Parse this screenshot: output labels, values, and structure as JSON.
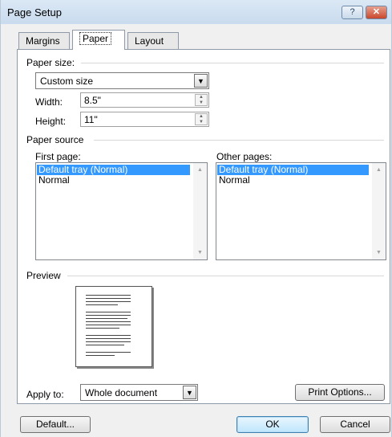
{
  "window": {
    "title": "Page Setup",
    "help_glyph": "?",
    "close_glyph": "✕"
  },
  "tabs": [
    {
      "label": "Margins"
    },
    {
      "label": "Paper"
    },
    {
      "label": "Layout"
    }
  ],
  "paper_size": {
    "heading": "Paper size:",
    "selected": "Custom size",
    "width_label": "Width:",
    "width_value": "8.5\"",
    "height_label": "Height:",
    "height_value": "11\""
  },
  "paper_source": {
    "heading": "Paper source",
    "first_page_label": "First page:",
    "first_page_items": [
      "Default tray (Normal)",
      "Normal"
    ],
    "other_pages_label": "Other pages:",
    "other_pages_items": [
      "Default tray (Normal)",
      "Normal"
    ]
  },
  "preview": {
    "heading": "Preview"
  },
  "apply": {
    "label": "Apply to:",
    "selected": "Whole document"
  },
  "buttons": {
    "print_options": "Print Options...",
    "default": "Default...",
    "ok": "OK",
    "cancel": "Cancel"
  },
  "icons": {
    "dropdown": "chevron-down-icon",
    "spin": "spin-updown-icon",
    "scroll_up": "scroll-up-icon",
    "scroll_down": "scroll-down-icon"
  }
}
